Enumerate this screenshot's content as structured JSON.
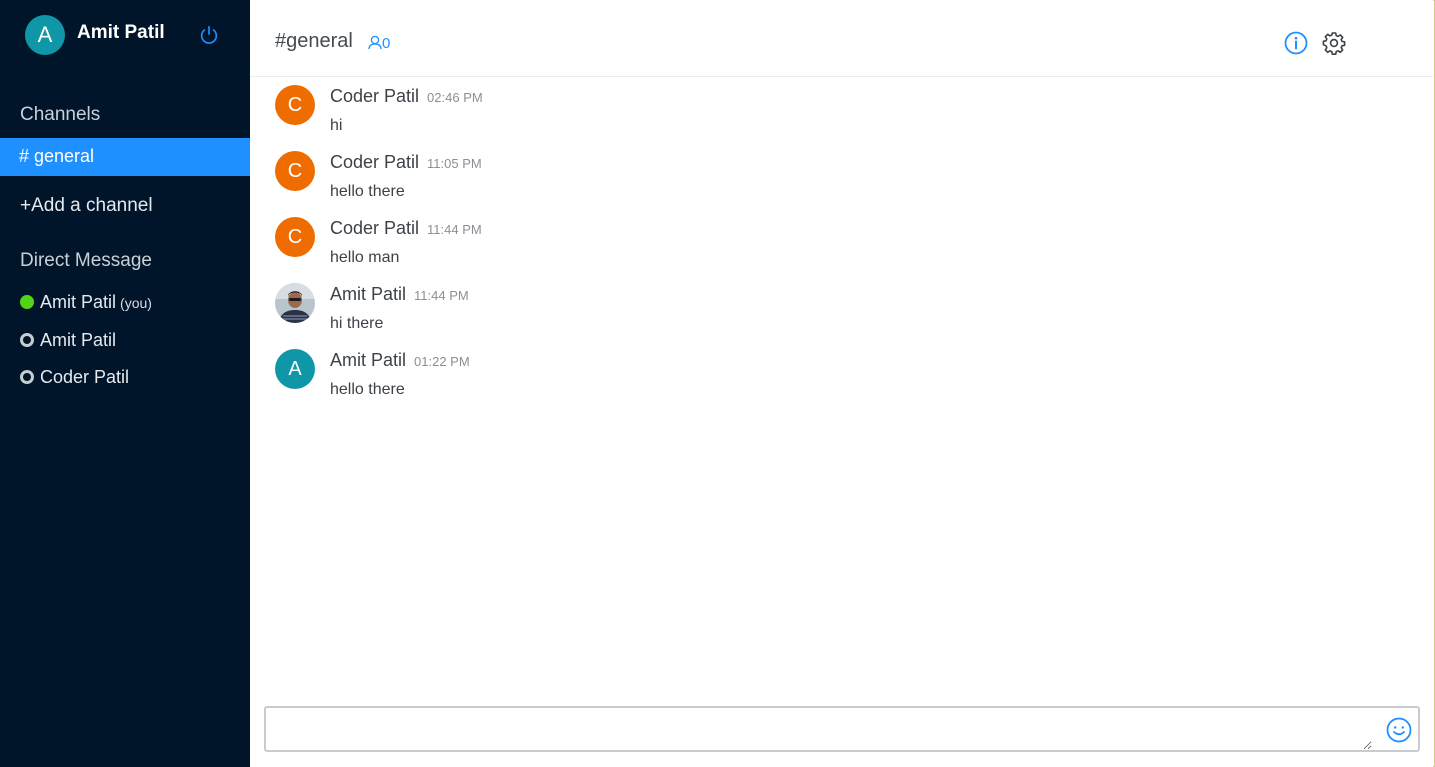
{
  "user": {
    "avatar_letter": "A",
    "name": "Amit Patil"
  },
  "sidebar": {
    "channels_title": "Channels",
    "active_channel": "# general",
    "add_channel": "+Add a channel",
    "dm_title": "Direct Message",
    "dms": [
      {
        "name": "Amit Patil",
        "suffix": "(you)",
        "status": "online"
      },
      {
        "name": "Amit Patil",
        "status": "offline"
      },
      {
        "name": "Coder Patil",
        "status": "offline"
      }
    ]
  },
  "header": {
    "channel": "#general",
    "member_count": "0"
  },
  "messages": [
    {
      "avatar": "C",
      "author": "Coder Patil",
      "time": "02:46 PM",
      "text": "hi"
    },
    {
      "avatar": "C",
      "author": "Coder Patil",
      "time": "11:05 PM",
      "text": "hello there"
    },
    {
      "avatar": "C",
      "author": "Coder Patil",
      "time": "11:44 PM",
      "text": "hello man"
    },
    {
      "avatar": "photo",
      "author": "Amit Patil",
      "time": "11:44 PM",
      "text": "hi there"
    },
    {
      "avatar": "A",
      "author": "Amit Patil",
      "time": "01:22 PM",
      "text": "hello there"
    }
  ],
  "composer": {
    "value": "",
    "placeholder": ""
  },
  "colors": {
    "sidebar_bg": "#00152a",
    "accent": "#1e90ff",
    "orange_avatar": "#ef6c00",
    "teal_avatar": "#0f97a8",
    "online": "#52d417"
  },
  "icons": [
    "power-icon",
    "user-icon",
    "info-icon",
    "gear-icon",
    "emoji-icon"
  ]
}
